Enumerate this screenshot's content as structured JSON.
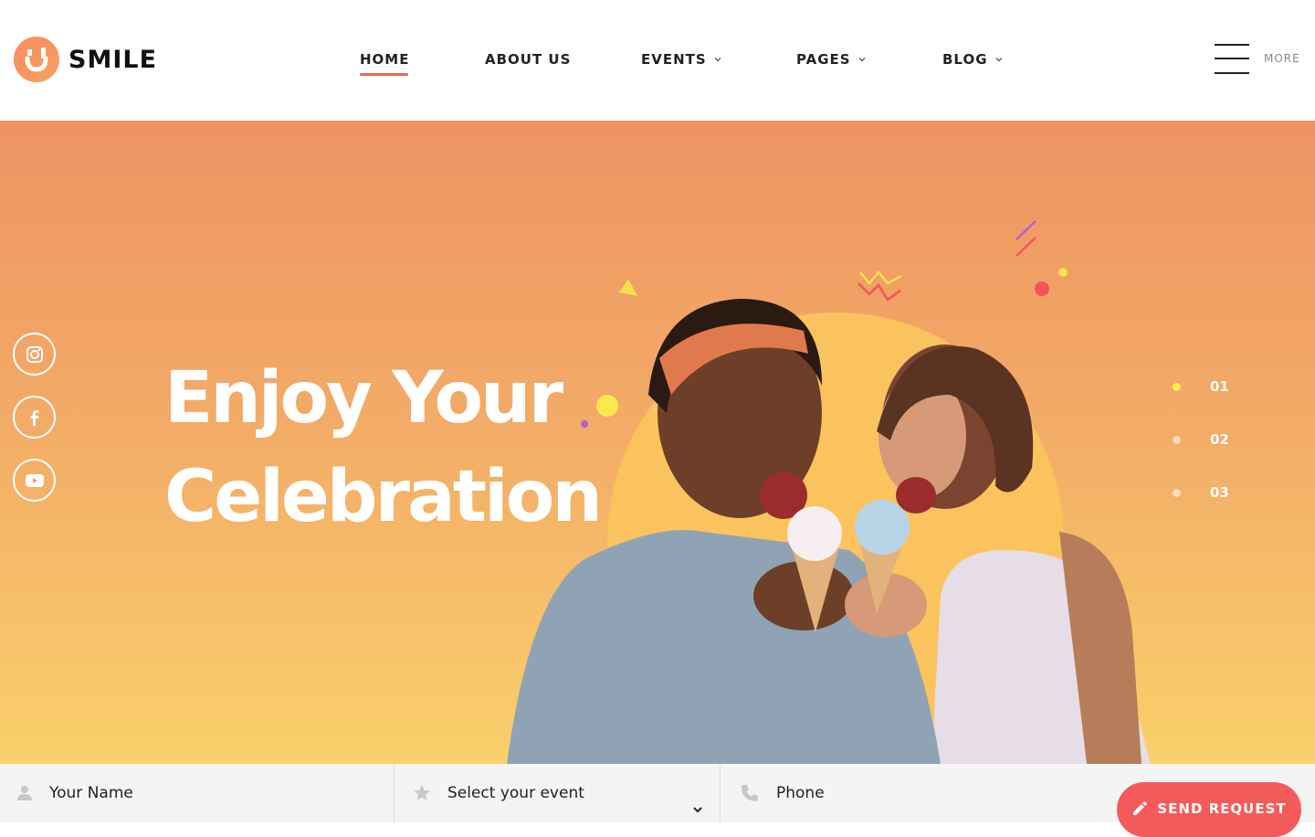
{
  "brand": {
    "name": "SMILE",
    "accent": "#f2605c",
    "logo_color": "#f58b62"
  },
  "nav": {
    "items": [
      {
        "label": "HOME",
        "active": true,
        "dropdown": false
      },
      {
        "label": "ABOUT US",
        "active": false,
        "dropdown": false
      },
      {
        "label": "EVENTS",
        "active": false,
        "dropdown": true
      },
      {
        "label": "PAGES",
        "active": false,
        "dropdown": true
      },
      {
        "label": "BLOG",
        "active": false,
        "dropdown": true
      }
    ],
    "more_label": "MORE"
  },
  "hero": {
    "headline_line1": "Enjoy Your",
    "headline_line2": "Celebration",
    "gradient_top": "#ee9363",
    "gradient_bottom": "#fad06b",
    "slides": [
      "01",
      "02",
      "03"
    ],
    "active_slide": 0,
    "social": [
      "instagram-icon",
      "facebook-icon",
      "youtube-icon"
    ]
  },
  "form": {
    "name_placeholder": "Your Name",
    "event_placeholder": "Select your event",
    "phone_placeholder": "Phone",
    "submit_label": "SEND REQUEST"
  }
}
